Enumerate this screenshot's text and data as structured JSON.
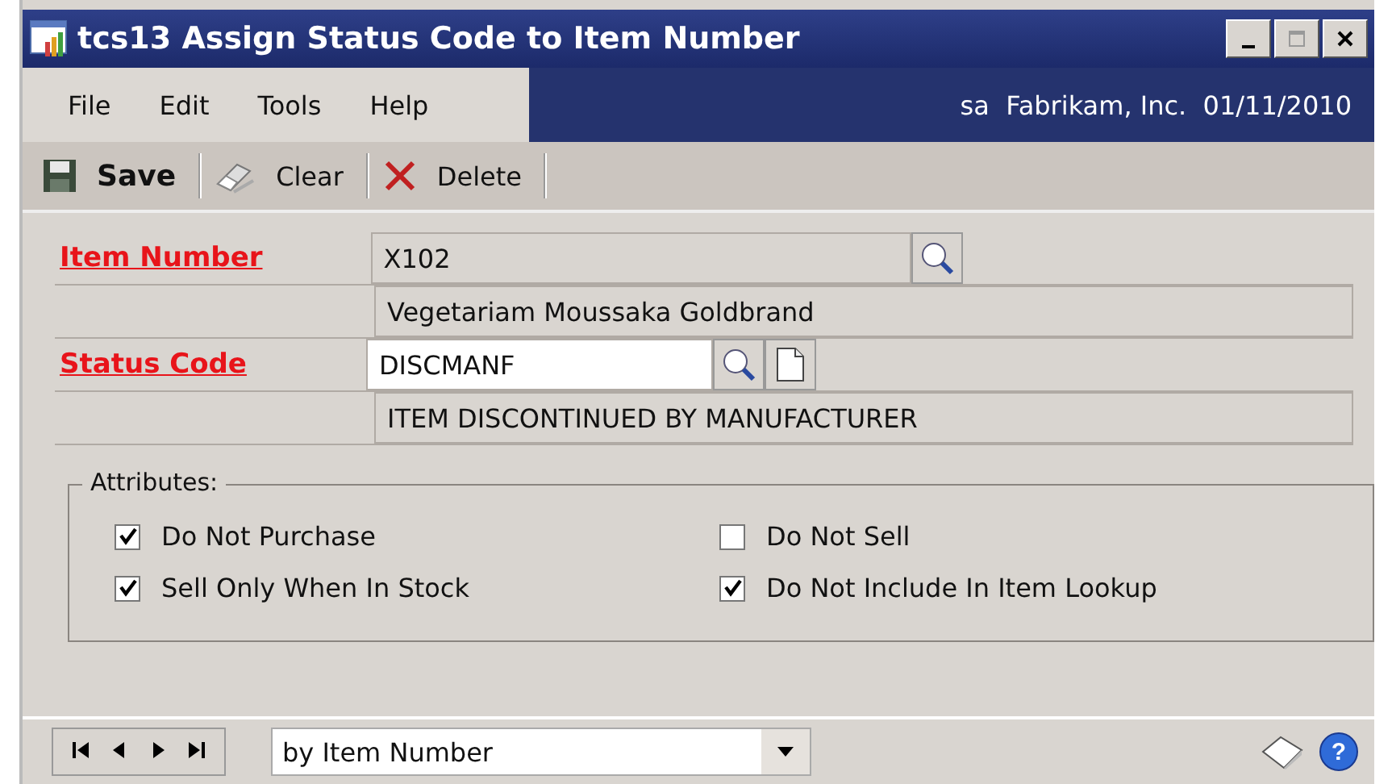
{
  "window": {
    "title": "tcs13 Assign Status Code to Item Number"
  },
  "menu": [
    "File",
    "Edit",
    "Tools",
    "Help"
  ],
  "session": "sa  Fabrikam, Inc.  01/11/2010",
  "toolbar": [
    {
      "kind": "save",
      "label": "Save"
    },
    {
      "kind": "clear",
      "label": "Clear"
    },
    {
      "kind": "delete",
      "label": "Delete"
    }
  ],
  "item_number": {
    "label": "Item Number",
    "value": "X102",
    "description": "Vegetariam Moussaka Goldbrand"
  },
  "status_code": {
    "label": "Status Code",
    "value": "DISCMANF",
    "description": "ITEM DISCONTINUED BY MANUFACTURER"
  },
  "attributes": {
    "title": "Attributes:",
    "options": [
      {
        "label": "Do Not Purchase",
        "checked": true
      },
      {
        "label": "Do Not Sell",
        "checked": false
      },
      {
        "label": "Sell Only When In Stock",
        "checked": true
      },
      {
        "label": "Do Not Include In Item Lookup",
        "checked": true
      }
    ]
  },
  "browse": {
    "sort": "by Item Number"
  },
  "help": "?"
}
